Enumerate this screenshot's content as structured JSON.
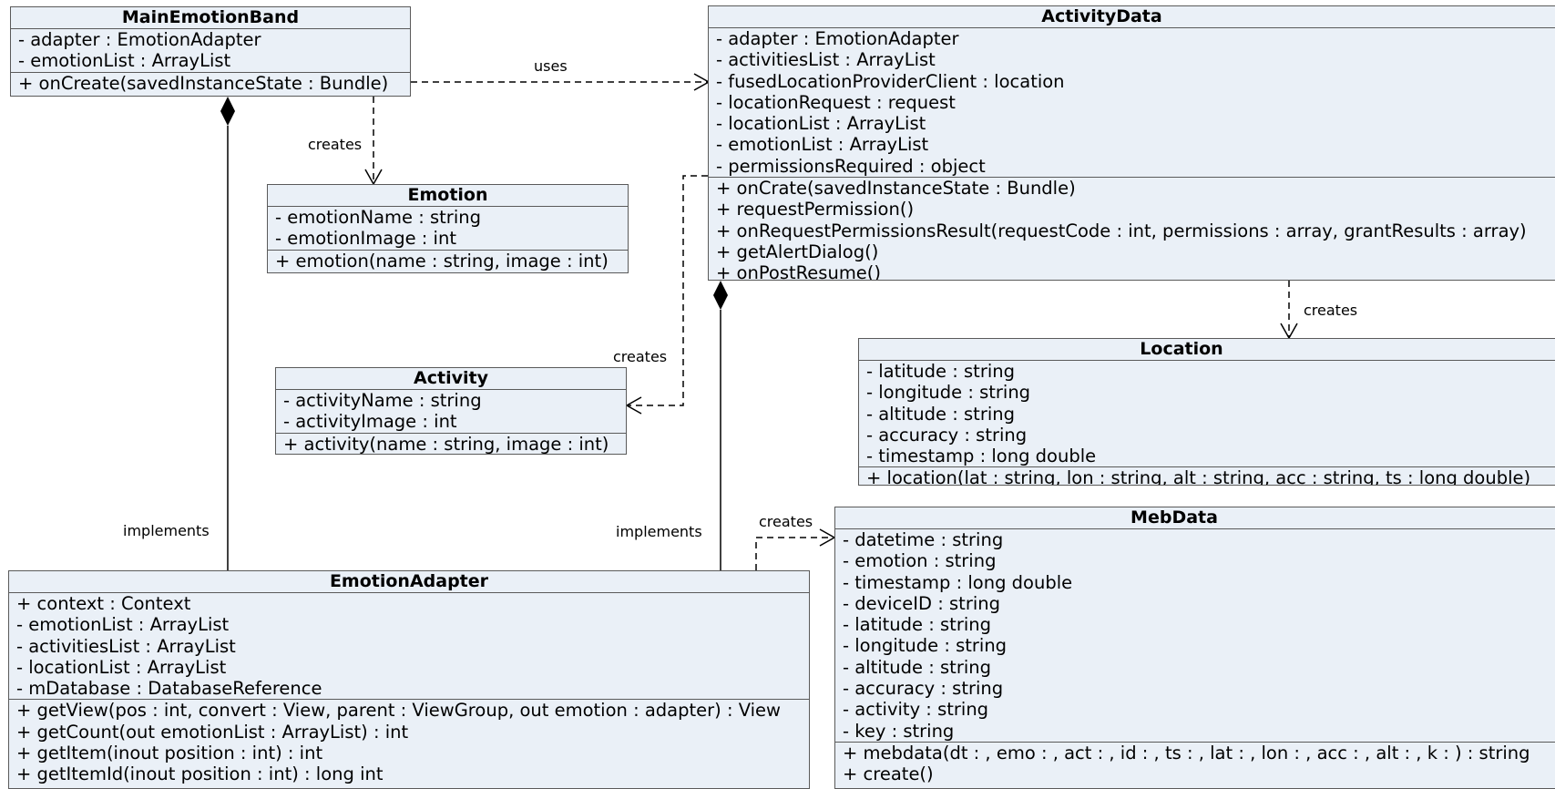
{
  "classes": [
    {
      "id": "main_emotion_band",
      "name": "MainEmotionBand",
      "attributes": [
        "- adapter : EmotionAdapter",
        "- emotionList : ArrayList"
      ],
      "methods": [
        "+ onCreate(savedInstanceState : Bundle)"
      ]
    },
    {
      "id": "emotion",
      "name": "Emotion",
      "attributes": [
        "- emotionName : string",
        "- emotionImage : int"
      ],
      "methods": [
        "+ emotion(name : string, image : int)"
      ]
    },
    {
      "id": "activity",
      "name": "Activity",
      "attributes": [
        "- activityName : string",
        "- activityImage : int"
      ],
      "methods": [
        "+ activity(name : string, image : int)"
      ]
    },
    {
      "id": "activity_data",
      "name": "ActivityData",
      "attributes": [
        "- adapter : EmotionAdapter",
        "- activitiesList : ArrayList",
        "- fusedLocationProviderClient : location",
        "- locationRequest : request",
        "- locationList : ArrayList",
        "- emotionList : ArrayList",
        "- permissionsRequired : object"
      ],
      "methods": [
        "+ onCrate(savedInstanceState : Bundle)",
        "+ requestPermission()",
        "+ onRequestPermissionsResult(requestCode : int, permissions : array, grantResults : array)",
        "+ getAlertDialog()",
        "+ onPostResume()"
      ]
    },
    {
      "id": "location",
      "name": "Location",
      "attributes": [
        "- latitude : string",
        "- longitude : string",
        "- altitude : string",
        "- accuracy : string",
        "- timestamp : long double"
      ],
      "methods": [
        "+ location(lat : string, lon : string, alt : string, acc : string, ts : long double)"
      ]
    },
    {
      "id": "emotion_adapter",
      "name": "EmotionAdapter",
      "attributes": [
        "+ context : Context",
        "- emotionList : ArrayList",
        "- activitiesList : ArrayList",
        "- locationList : ArrayList",
        "- mDatabase : DatabaseReference"
      ],
      "methods": [
        "+ getView(pos : int, convert : View, parent : ViewGroup, out emotion : adapter) : View",
        "+ getCount(out emotionList : ArrayList) : int",
        "+ getItem(inout position : int) : int",
        "+ getItemId(inout position : int) : long int"
      ]
    },
    {
      "id": "meb_data",
      "name": "MebData",
      "attributes": [
        "- datetime : string",
        "- emotion : string",
        "- timestamp : long double",
        "- deviceID : string",
        "- latitude : string",
        "- longitude : string",
        "- altitude : string",
        "- accuracy : string",
        "- activity : string",
        "- key : string"
      ],
      "methods": [
        "+ mebdata(dt : , emo : , act : , id : , ts : , lat : , lon : , acc : , alt : , k : ) : string",
        "+ create()"
      ]
    }
  ],
  "relations": [
    {
      "from": "main_emotion_band",
      "to": "activity_data",
      "kind": "dependency",
      "label": "uses"
    },
    {
      "from": "main_emotion_band",
      "to": "emotion",
      "kind": "dependency",
      "label": "creates"
    },
    {
      "from": "activity_data",
      "to": "activity",
      "kind": "dependency",
      "label": "creates"
    },
    {
      "from": "activity_data",
      "to": "location",
      "kind": "dependency",
      "label": "creates"
    },
    {
      "from": "emotion_adapter",
      "to": "meb_data",
      "kind": "dependency",
      "label": "creates"
    },
    {
      "from": "main_emotion_band",
      "to": "emotion_adapter",
      "kind": "composition",
      "label": "implements"
    },
    {
      "from": "activity_data",
      "to": "emotion_adapter",
      "kind": "composition",
      "label": "implements"
    }
  ]
}
